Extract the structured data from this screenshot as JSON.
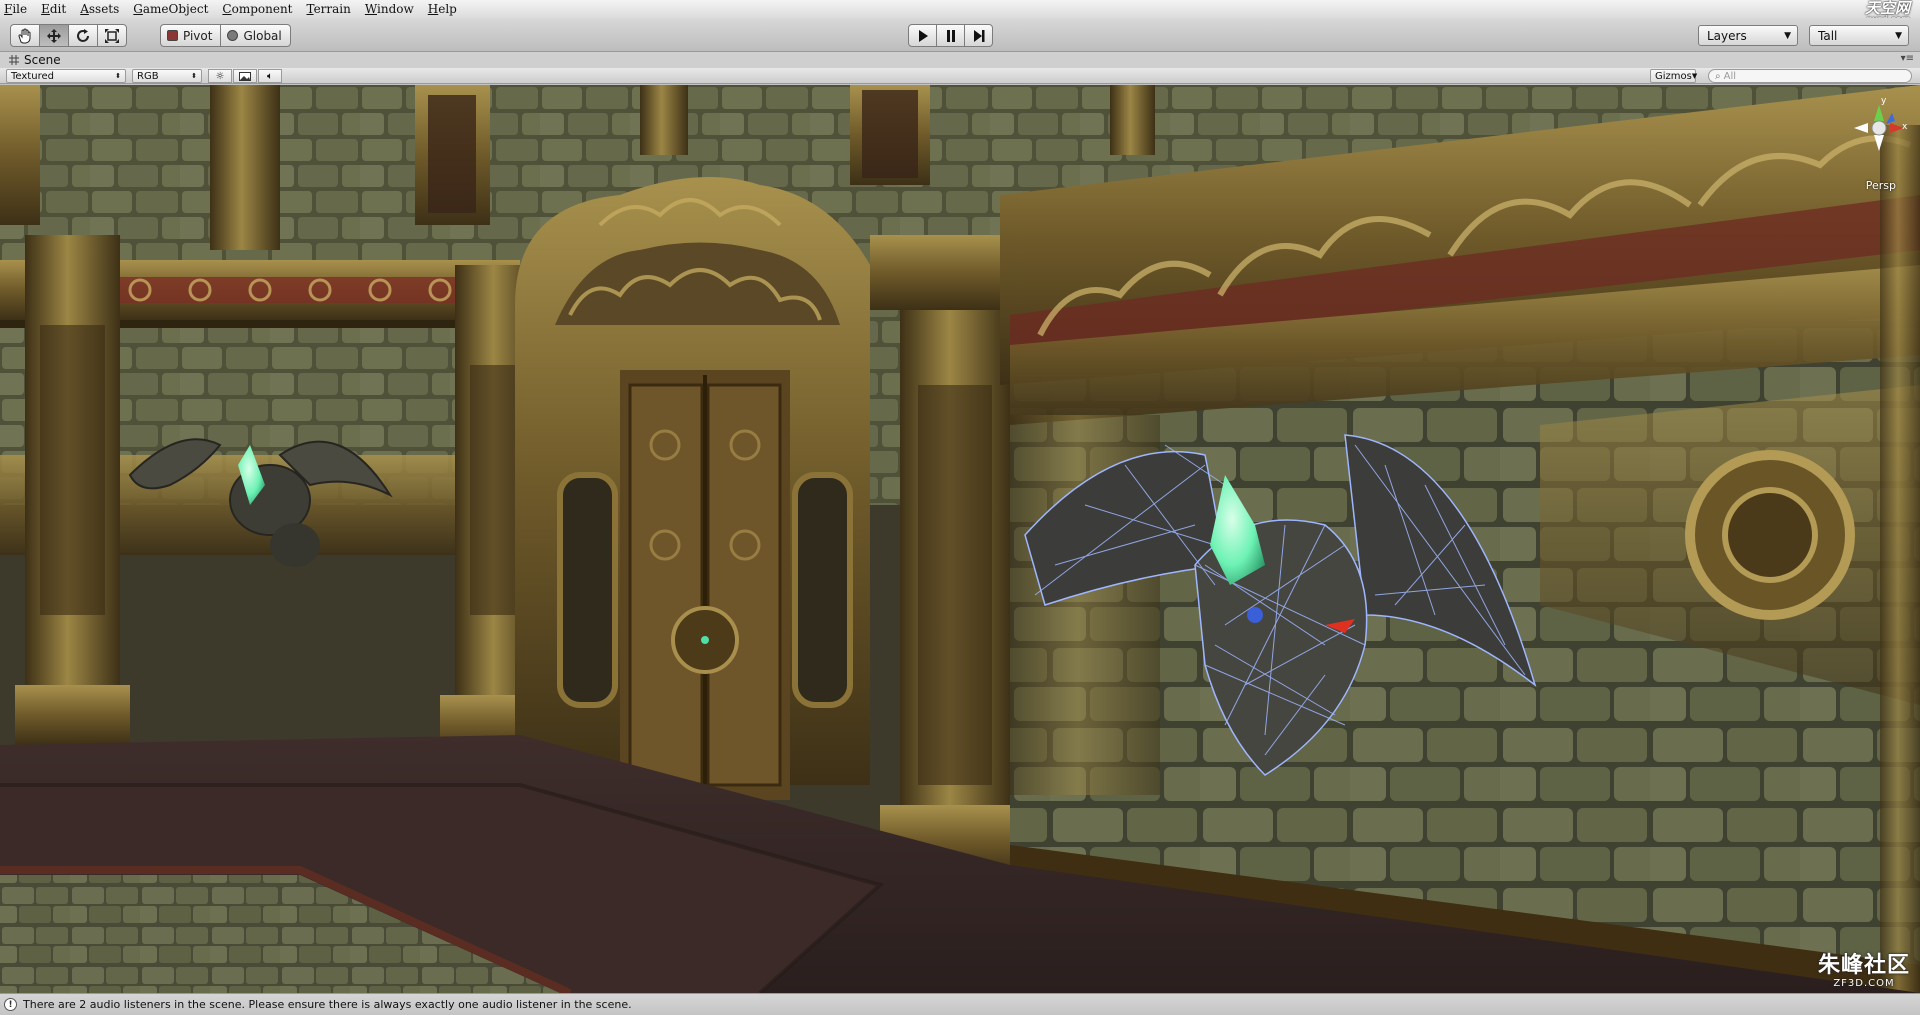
{
  "menu": [
    "File",
    "Edit",
    "Assets",
    "GameObject",
    "Component",
    "Terrain",
    "Window",
    "Help"
  ],
  "watermark_top": {
    "line1": "天空网",
    "line2": "nxsd.com"
  },
  "toolbar": {
    "pivot_label": "Pivot",
    "global_label": "Global",
    "layers_label": "Layers",
    "layout_label": "Tall"
  },
  "scene_tab": {
    "title": "Scene",
    "menu_glyph": "▾≡"
  },
  "scene_toolbar": {
    "render_mode": "Textured",
    "channel": "RGB",
    "gizmos_label": "Gizmos",
    "search_placeholder": "All"
  },
  "viewport": {
    "projection": "Persp",
    "gizmo_y_label": "y"
  },
  "watermark_bottom": {
    "line1": "朱峰社区",
    "line2": "ZF3D.COM"
  },
  "status": {
    "icon": "info-icon",
    "message": "There are 2 audio listeners in the scene. Please ensure there is always exactly one audio listener in the scene."
  },
  "colors": {
    "selection_wire": "#9fb6ff",
    "crystal": "#6df2b4",
    "pivot_swatch": "#c03030",
    "global_swatch": "#707070"
  }
}
